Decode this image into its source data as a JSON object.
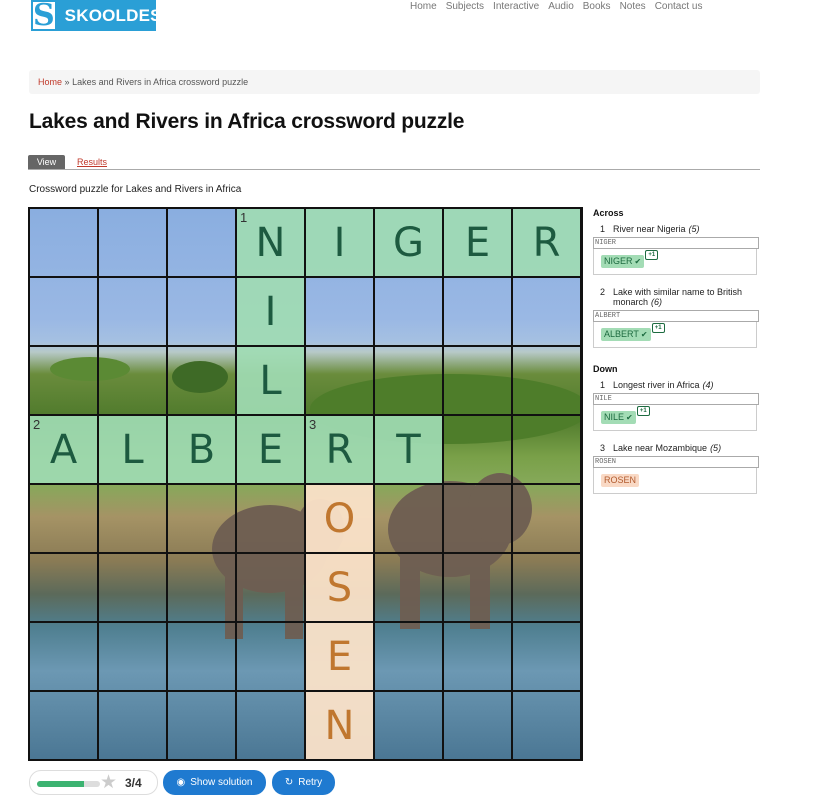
{
  "header": {
    "logo_letter": "S",
    "logo_text": "SKOOLDESK",
    "nav": [
      "Home",
      "Subjects",
      "Interactive",
      "Audio",
      "Books",
      "Notes",
      "Contact us"
    ]
  },
  "breadcrumb": {
    "home": "Home",
    "separator": "»",
    "current": "Lakes and Rivers in Africa crossword puzzle"
  },
  "page_title": "Lakes and Rivers in Africa crossword puzzle",
  "tabs": {
    "view": "View",
    "results": "Results"
  },
  "description": "Crossword puzzle for Lakes and Rivers in Africa",
  "grid": {
    "rows": 8,
    "cols": 8,
    "cells": [
      {
        "r": 0,
        "c": 3,
        "letter": "N",
        "num": "1",
        "style": "green"
      },
      {
        "r": 0,
        "c": 4,
        "letter": "I",
        "num": "",
        "style": "green"
      },
      {
        "r": 0,
        "c": 5,
        "letter": "G",
        "num": "",
        "style": "green"
      },
      {
        "r": 0,
        "c": 6,
        "letter": "E",
        "num": "",
        "style": "green"
      },
      {
        "r": 0,
        "c": 7,
        "letter": "R",
        "num": "",
        "style": "green"
      },
      {
        "r": 1,
        "c": 3,
        "letter": "I",
        "num": "",
        "style": "green"
      },
      {
        "r": 2,
        "c": 3,
        "letter": "L",
        "num": "",
        "style": "green"
      },
      {
        "r": 3,
        "c": 0,
        "letter": "A",
        "num": "2",
        "style": "green"
      },
      {
        "r": 3,
        "c": 1,
        "letter": "L",
        "num": "",
        "style": "green"
      },
      {
        "r": 3,
        "c": 2,
        "letter": "B",
        "num": "",
        "style": "green"
      },
      {
        "r": 3,
        "c": 3,
        "letter": "E",
        "num": "",
        "style": "green"
      },
      {
        "r": 3,
        "c": 4,
        "letter": "R",
        "num": "3",
        "style": "green"
      },
      {
        "r": 3,
        "c": 5,
        "letter": "T",
        "num": "",
        "style": "green"
      },
      {
        "r": 4,
        "c": 4,
        "letter": "O",
        "num": "",
        "style": "orange"
      },
      {
        "r": 5,
        "c": 4,
        "letter": "S",
        "num": "",
        "style": "orange"
      },
      {
        "r": 6,
        "c": 4,
        "letter": "E",
        "num": "",
        "style": "orange"
      },
      {
        "r": 7,
        "c": 4,
        "letter": "N",
        "num": "",
        "style": "orange"
      }
    ]
  },
  "clues": {
    "across_label": "Across",
    "down_label": "Down",
    "across": [
      {
        "num": "1",
        "text": "River near Nigeria",
        "len": "(5)",
        "input": "NIGER",
        "answer": "NIGER",
        "correct": true,
        "badge": "+1"
      },
      {
        "num": "2",
        "text": "Lake with similar name to British monarch",
        "len": "(6)",
        "input": "ALBERT",
        "answer": "ALBERT",
        "correct": true,
        "badge": "+1"
      }
    ],
    "down": [
      {
        "num": "1",
        "text": "Longest river in Africa",
        "len": "(4)",
        "input": "NILE",
        "answer": "NILE",
        "correct": true,
        "badge": "+1"
      },
      {
        "num": "3",
        "text": "Lake near Mozambique",
        "len": "(5)",
        "input": "ROSEN",
        "answer": "ROSEN",
        "correct": false,
        "badge": ""
      }
    ]
  },
  "score": {
    "text": "3/4",
    "fraction": 0.75
  },
  "buttons": {
    "show_solution": "Show solution",
    "retry": "Retry"
  },
  "colors": {
    "accent": "#1f7ad0",
    "correct": "#a3dcb5",
    "wrong": "#f9d9c5",
    "link": "#c0392b"
  }
}
